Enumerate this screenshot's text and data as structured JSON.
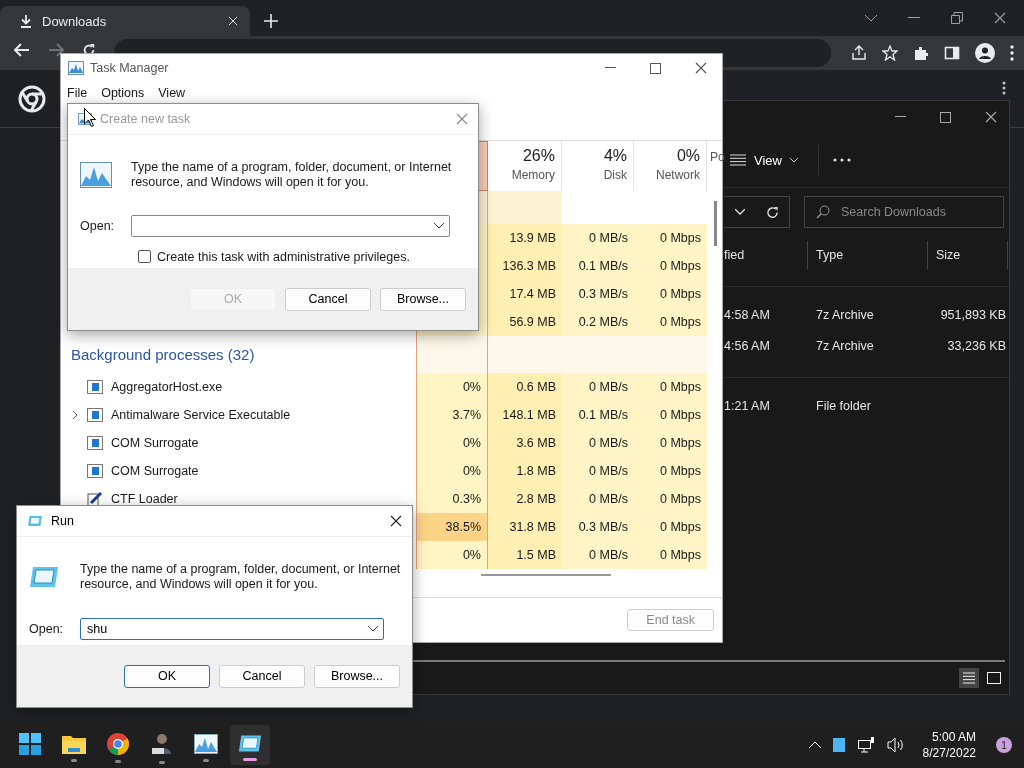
{
  "browser": {
    "tab": {
      "title": "Downloads",
      "selected": true
    }
  },
  "explorer": {
    "view_button": "View",
    "search": {
      "placeholder": "Search Downloads"
    },
    "columns": [
      "fied",
      "Type",
      "Size"
    ],
    "groups": [
      {
        "rows": [
          {
            "modified": "4:58 AM",
            "type": "7z Archive",
            "size": "951,893 KB"
          },
          {
            "modified": "4:56 AM",
            "type": "7z Archive",
            "size": "33,236 KB"
          }
        ]
      },
      {
        "rows": [
          {
            "modified": "1:21 AM",
            "type": "File folder"
          }
        ]
      }
    ]
  },
  "task_manager": {
    "title": "Task Manager",
    "menu": [
      "File",
      "Options",
      "View"
    ],
    "columns": [
      {
        "percent": "26%",
        "label": "Memory"
      },
      {
        "percent": "4%",
        "label": "Disk"
      },
      {
        "percent": "0%",
        "label": "Network"
      },
      {
        "label": "Po"
      }
    ],
    "rows": [
      {
        "kind": "app",
        "memory": "13.9 MB",
        "disk": "0 MB/s",
        "network": "0 Mbps"
      },
      {
        "kind": "app",
        "memory": "136.3 MB",
        "disk": "0.1 MB/s",
        "network": "0 Mbps"
      },
      {
        "kind": "app",
        "memory": "17.4 MB",
        "disk": "0.3 MB/s",
        "network": "0 Mbps"
      },
      {
        "kind": "app",
        "memory": "56.9 MB",
        "disk": "0.2 MB/s",
        "network": "0 Mbps"
      },
      {
        "kind": "group",
        "label": "Background processes (32)"
      },
      {
        "kind": "process",
        "name": "AggregatorHost.exe",
        "expandable": false,
        "high_cpu": false,
        "cpu": "0%",
        "memory": "0.6 MB",
        "disk": "0 MB/s",
        "network": "0 Mbps"
      },
      {
        "kind": "process",
        "name": "Antimalware Service Executable",
        "expandable": true,
        "high_cpu": false,
        "cpu": "3.7%",
        "memory": "148.1 MB",
        "disk": "0.1 MB/s",
        "network": "0 Mbps"
      },
      {
        "kind": "process",
        "name": "COM Surrogate",
        "expandable": false,
        "high_cpu": false,
        "cpu": "0%",
        "memory": "3.6 MB",
        "disk": "0 MB/s",
        "network": "0 Mbps"
      },
      {
        "kind": "process",
        "name": "COM Surrogate",
        "expandable": false,
        "high_cpu": false,
        "cpu": "0%",
        "memory": "1.8 MB",
        "disk": "0 MB/s",
        "network": "0 Mbps"
      },
      {
        "kind": "tool",
        "name": "CTF Loader",
        "expandable": false,
        "high_cpu": false,
        "cpu": "0.3%",
        "memory": "2.8 MB",
        "disk": "0 MB/s",
        "network": "0 Mbps"
      },
      {
        "kind": "process",
        "high_cpu": true,
        "cpu": "38.5%",
        "memory": "31.8 MB",
        "disk": "0.3 MB/s",
        "network": "0 Mbps"
      },
      {
        "kind": "process",
        "high_cpu": false,
        "cpu": "0%",
        "memory": "1.5 MB",
        "disk": "0 MB/s",
        "network": "0 Mbps"
      }
    ],
    "end_task": {
      "label": "End task",
      "disabled": true
    }
  },
  "create_task_dialog": {
    "kind": "create-task",
    "title": "Create new task",
    "active": false,
    "message": "Type the name of a program, folder, document, or Internet resource, and Windows will open it for you.",
    "open_label": "Open:",
    "admin_checkbox": {
      "label": "Create this task with administrative privileges.",
      "checked": false
    },
    "buttons": [
      {
        "label": "OK",
        "disabled": true,
        "default": false
      },
      {
        "label": "Cancel",
        "disabled": false,
        "default": false
      },
      {
        "label": "Browse...",
        "disabled": false,
        "default": false
      }
    ]
  },
  "run_dialog": {
    "kind": "run",
    "title": "Run",
    "active": true,
    "message": "Type the name of a program, folder, document, or Internet resource, and Windows will open it for you.",
    "open_label": "Open:",
    "open_value": "shu",
    "buttons": [
      {
        "label": "OK",
        "disabled": false,
        "default": true
      },
      {
        "label": "Cancel",
        "disabled": false,
        "default": false
      },
      {
        "label": "Browse...",
        "disabled": false,
        "default": false
      }
    ]
  },
  "taskbar": {
    "apps": [
      {
        "kind": "start",
        "running": false,
        "active": false
      },
      {
        "kind": "folder",
        "running": true,
        "active": false
      },
      {
        "kind": "chrome",
        "running": true,
        "active": false
      },
      {
        "kind": "person",
        "running": true,
        "active": false
      },
      {
        "kind": "monitor",
        "running": true,
        "active": false
      },
      {
        "kind": "run",
        "running": true,
        "active": true
      }
    ],
    "time": "5:00 AM",
    "date": "8/27/2022",
    "notifications": "1"
  }
}
